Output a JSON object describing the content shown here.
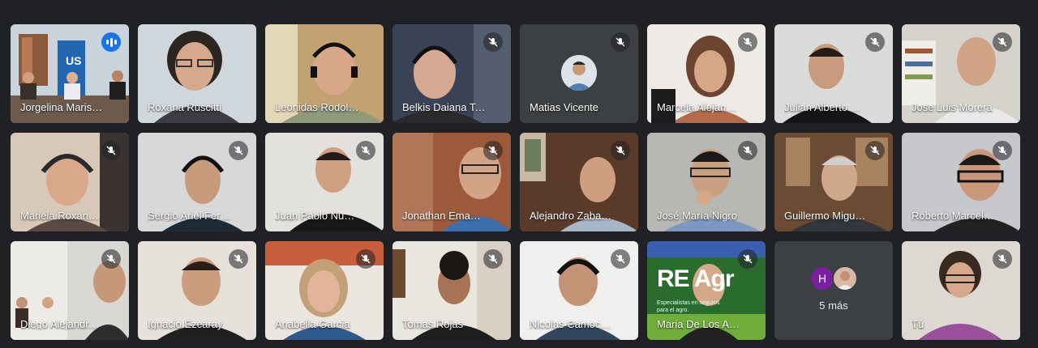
{
  "colors": {
    "background": "#202124",
    "tile": "#3c4043",
    "active_border": "#8ab4f8",
    "speaking_badge": "#1a73e8"
  },
  "participants": [
    {
      "name": "Jorgelina Marisol…",
      "muted": false,
      "speaking": true
    },
    {
      "name": "Roxana Ruscitti",
      "muted": false
    },
    {
      "name": "Leonidas Rodolf…",
      "muted": false
    },
    {
      "name": "Belkis Daiana Ter…",
      "muted": true
    },
    {
      "name": "Matias Vicente",
      "muted": true,
      "camera_off": true
    },
    {
      "name": "Marcela Alejandr…",
      "muted": true
    },
    {
      "name": "Julian Alberto Ni…",
      "muted": true
    },
    {
      "name": "Jose Luis Morera",
      "muted": true
    },
    {
      "name": "Mariela Roxana …",
      "muted": true
    },
    {
      "name": "Sergio Ariel Fern…",
      "muted": true
    },
    {
      "name": "Juan Pablo Nuñez",
      "muted": true
    },
    {
      "name": "Jonathan Emanu…",
      "muted": true
    },
    {
      "name": "Alejandro Zabalett",
      "muted": true
    },
    {
      "name": "José María Nigro",
      "muted": true
    },
    {
      "name": "Guillermo Migue…",
      "muted": true
    },
    {
      "name": "Roberto Marcelo…",
      "muted": true
    },
    {
      "name": "Diego Alejandro …",
      "muted": true
    },
    {
      "name": "Ignacio Ezcaray",
      "muted": true
    },
    {
      "name": "Anabella Garcia",
      "muted": true
    },
    {
      "name": "Tomas Rojas",
      "muted": true
    },
    {
      "name": "Nicolas Camocar…",
      "muted": true
    },
    {
      "name": "Maria De Los An…",
      "muted": true
    },
    {
      "name": "Tú",
      "muted": true
    }
  ],
  "wall_text": "US",
  "banner": {
    "brand": "RE Agr",
    "subtext": "Especialistas en seguros para el agro."
  },
  "overflow": {
    "label": "5 más",
    "avatar_initial": "H",
    "avatar_color": "#7b1fa2"
  },
  "icons": {
    "mute": "mic-off-icon",
    "speaking": "audio-bars-icon"
  }
}
